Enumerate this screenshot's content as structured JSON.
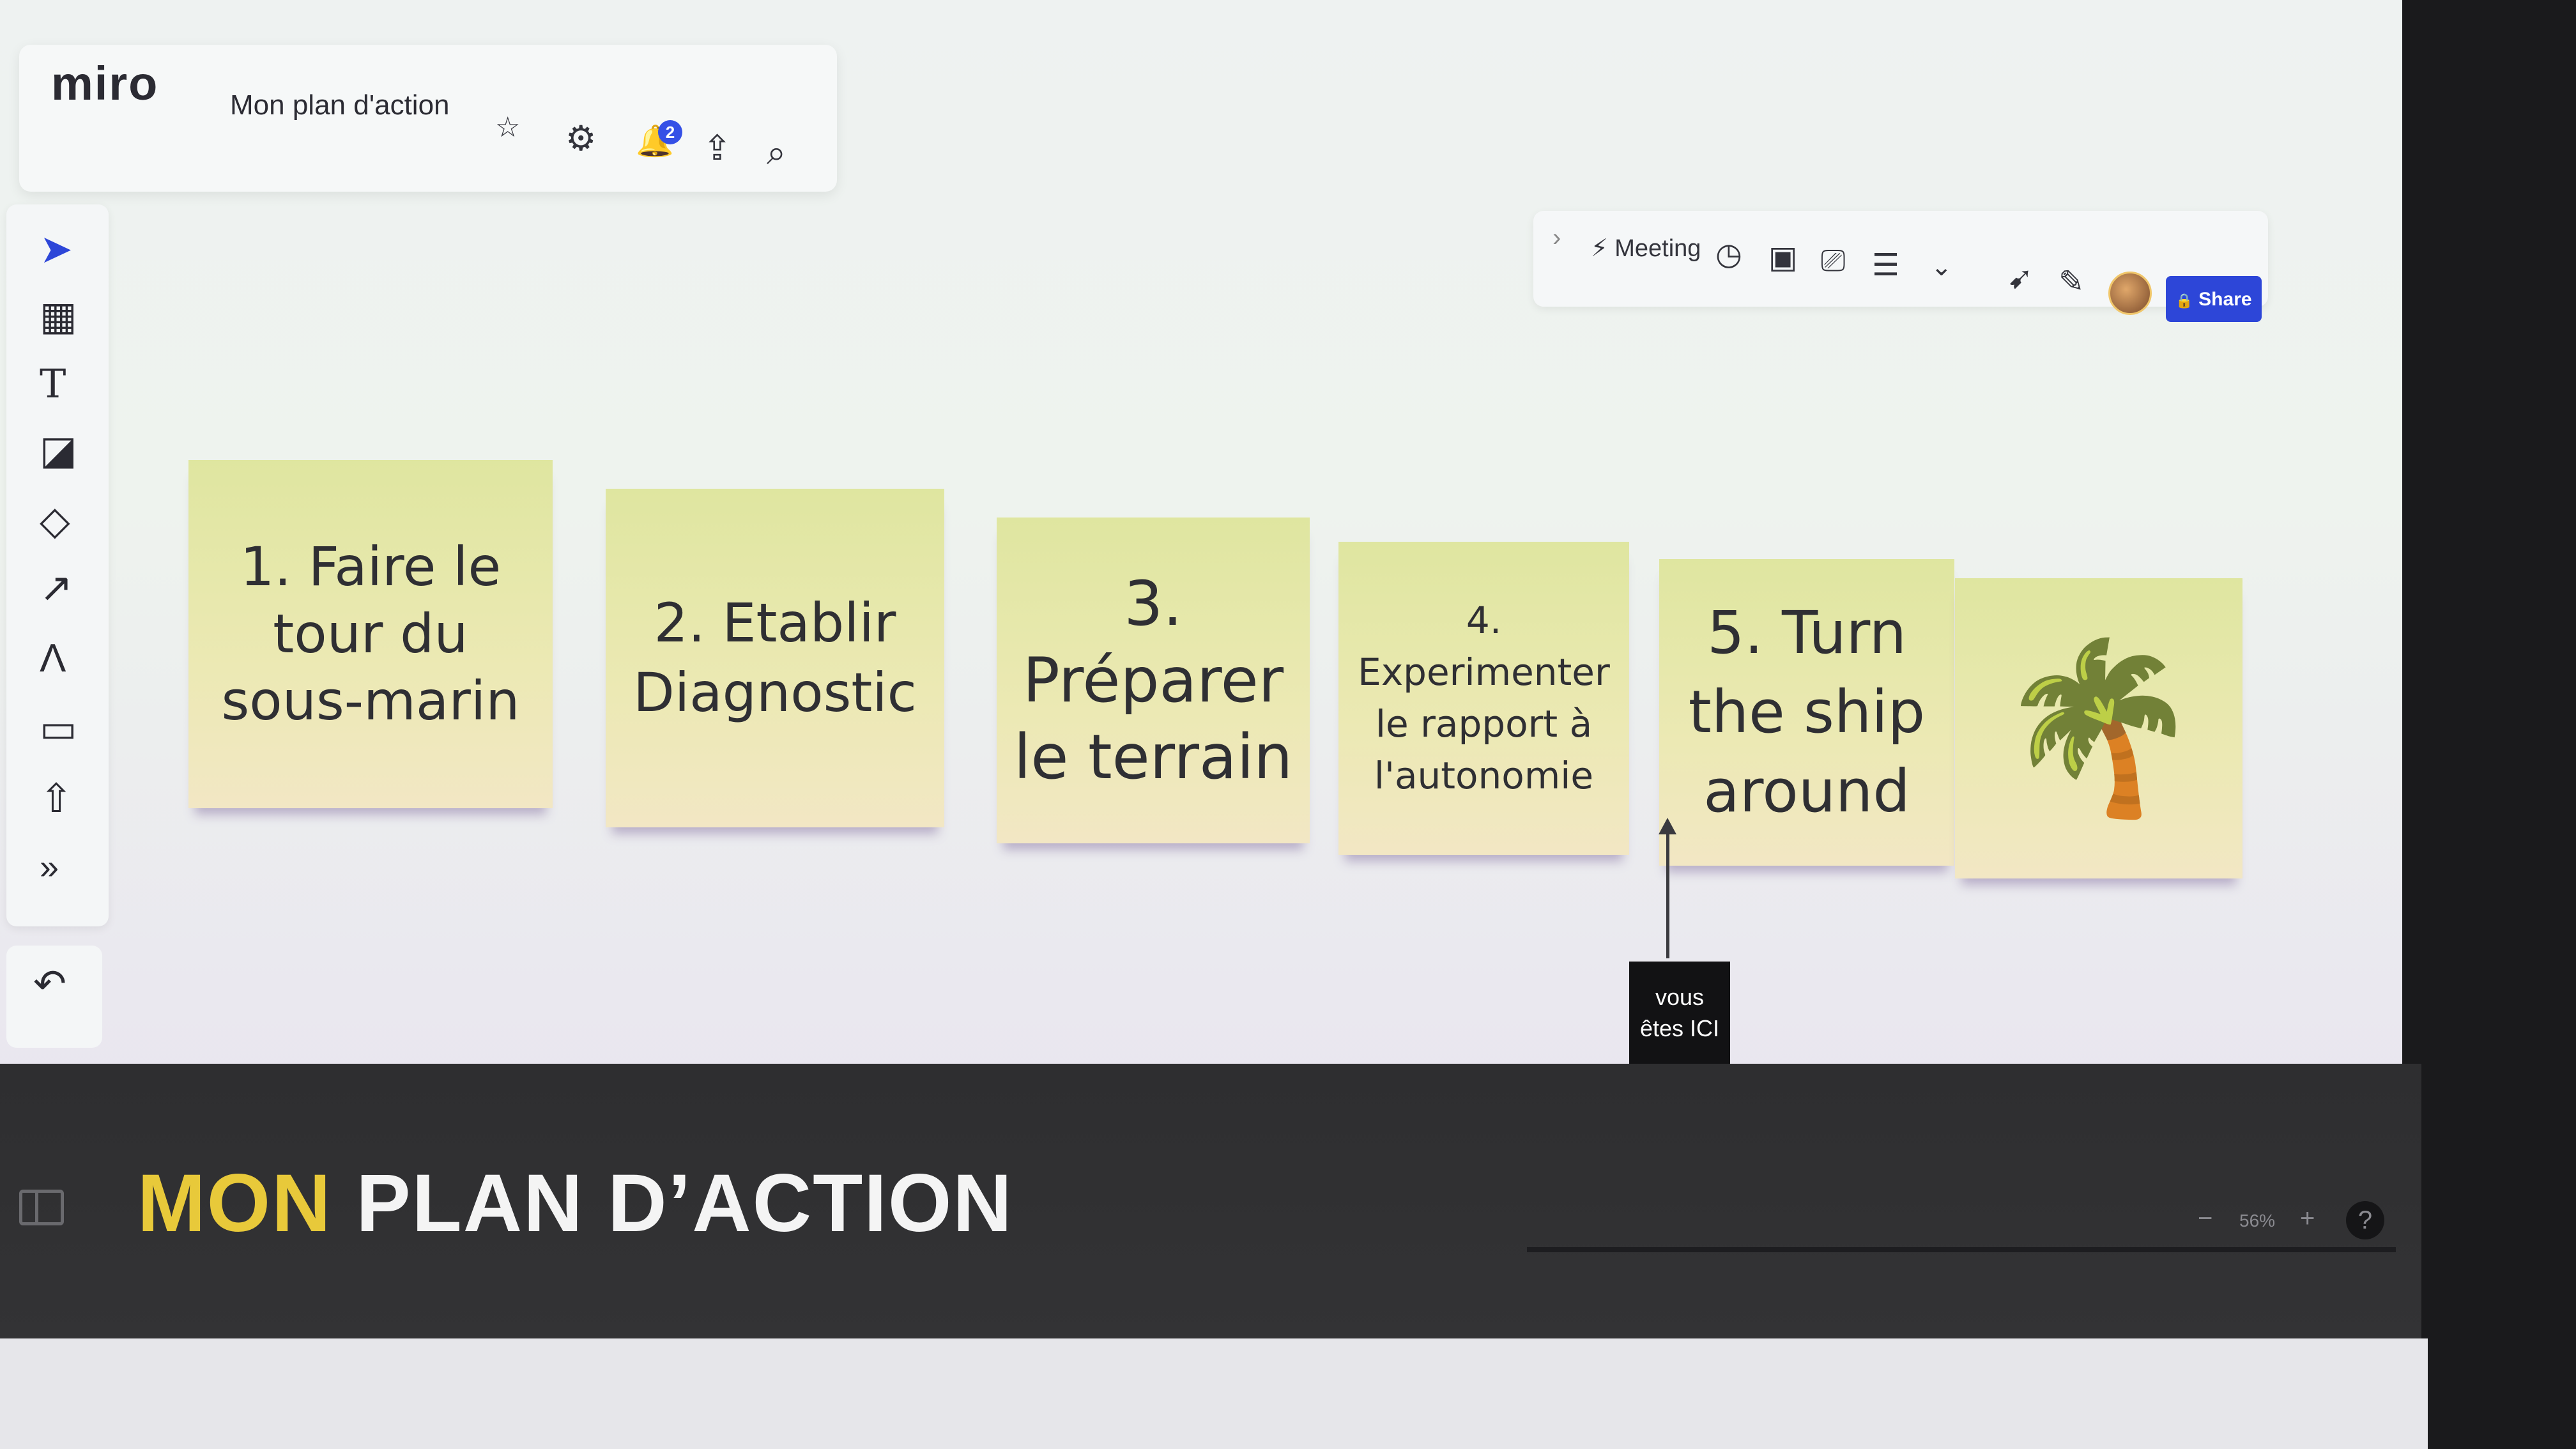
{
  "app": {
    "logo": "miro",
    "board_title": "Mon plan d'action"
  },
  "top_toolbar": {
    "star": "☆",
    "settings": "⚙",
    "notifications": "🔔",
    "notification_count": "2",
    "export": "⇪",
    "search": "⌕"
  },
  "right_toolbar": {
    "expand": "›",
    "meeting_label": "Meeting",
    "timer": "◷",
    "card": "▣",
    "present": "⎚",
    "notes": "☰",
    "more": "⌄",
    "cursor_filter": "➹",
    "reactions": "✎",
    "share_label": "Share",
    "lock": "🔒"
  },
  "left_toolbar": {
    "select": "➤",
    "templates": "▦",
    "text": "T",
    "sticky": "◪",
    "shapes": "◇",
    "connector": "↗",
    "pen": "Λ",
    "comment": "▭",
    "upload": "⇧",
    "more": "»",
    "undo": "↶"
  },
  "stickies": [
    {
      "text": "1. Faire le\ntour du\nsous-marin"
    },
    {
      "text": "2. Etablir\nDiagnostic"
    },
    {
      "text": "3.\nPréparer\nle terrain"
    },
    {
      "text": "4.\nExperimenter\nle rapport à\nl'autonomie"
    },
    {
      "text": "5. Turn\nthe ship\naround"
    },
    {
      "text": "🌴"
    }
  ],
  "marker": {
    "text": "vous\nêtes ICI"
  },
  "footer": {
    "title_highlight": "MON",
    "title_rest": "PLAN D’ACTION",
    "zoom_minus": "−",
    "zoom_level": "56%",
    "zoom_plus": "+",
    "help": "?"
  },
  "colors": {
    "accent": "#2d46d8",
    "highlight": "#e8c93a",
    "sticky": "#e6e8aa"
  }
}
